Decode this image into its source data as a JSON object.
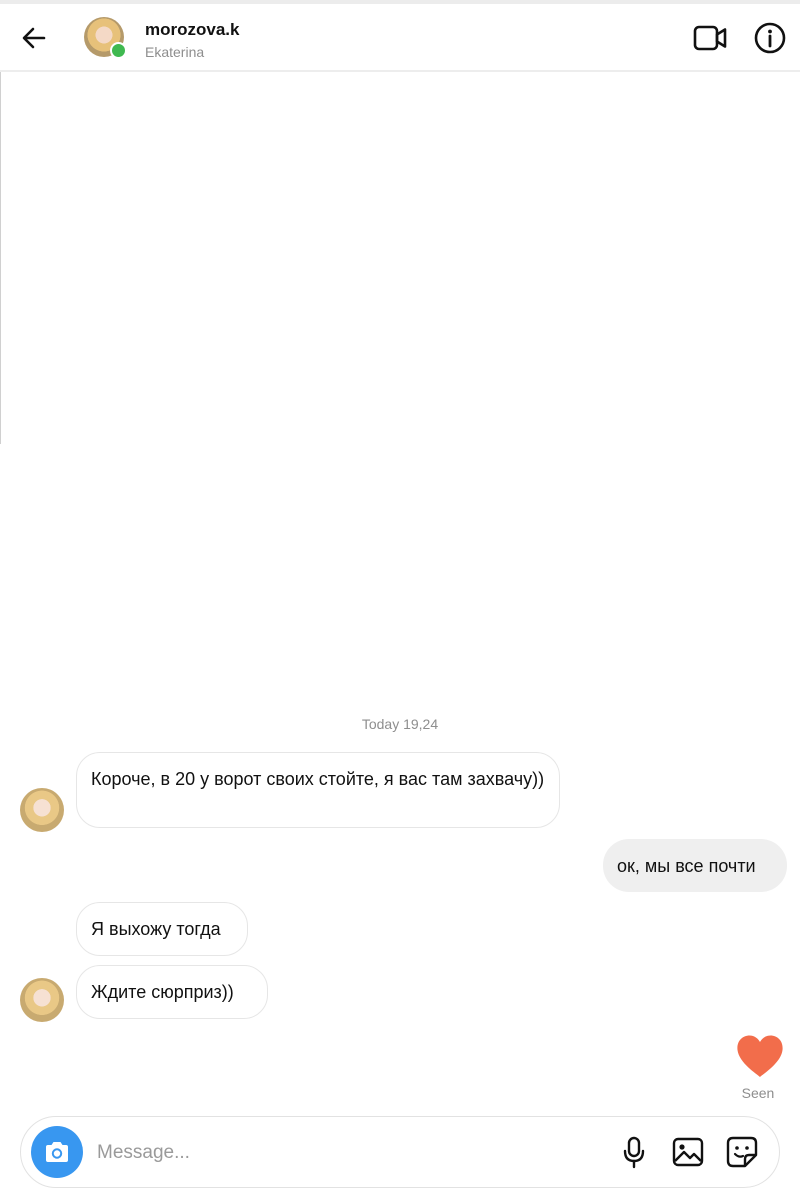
{
  "header": {
    "username": "morozova.k",
    "subname": "Ekaterina",
    "icons": {
      "back": "back-arrow-icon",
      "video": "video-call-icon",
      "info": "info-icon"
    },
    "online": true,
    "online_color": "#3fb950"
  },
  "chat": {
    "timestamp": "Today 19,24",
    "messages": [
      {
        "from": "them",
        "text": "Короче, в 20 у ворот своих стойте, я вас там захвачу))"
      },
      {
        "from": "me",
        "text": "ок, мы все почти"
      },
      {
        "from": "them",
        "text": "Я выхожу тогда"
      },
      {
        "from": "them",
        "text": "Ждите сюрприз))"
      }
    ],
    "reaction": {
      "icon": "heart-icon",
      "color": "#f26d4b"
    },
    "seen_label": "Seen"
  },
  "composer": {
    "placeholder": "Message...",
    "value": "",
    "camera_color": "#3897f0",
    "icons": {
      "camera": "camera-icon",
      "mic": "microphone-icon",
      "gallery": "gallery-icon",
      "sticker": "sticker-icon"
    }
  }
}
